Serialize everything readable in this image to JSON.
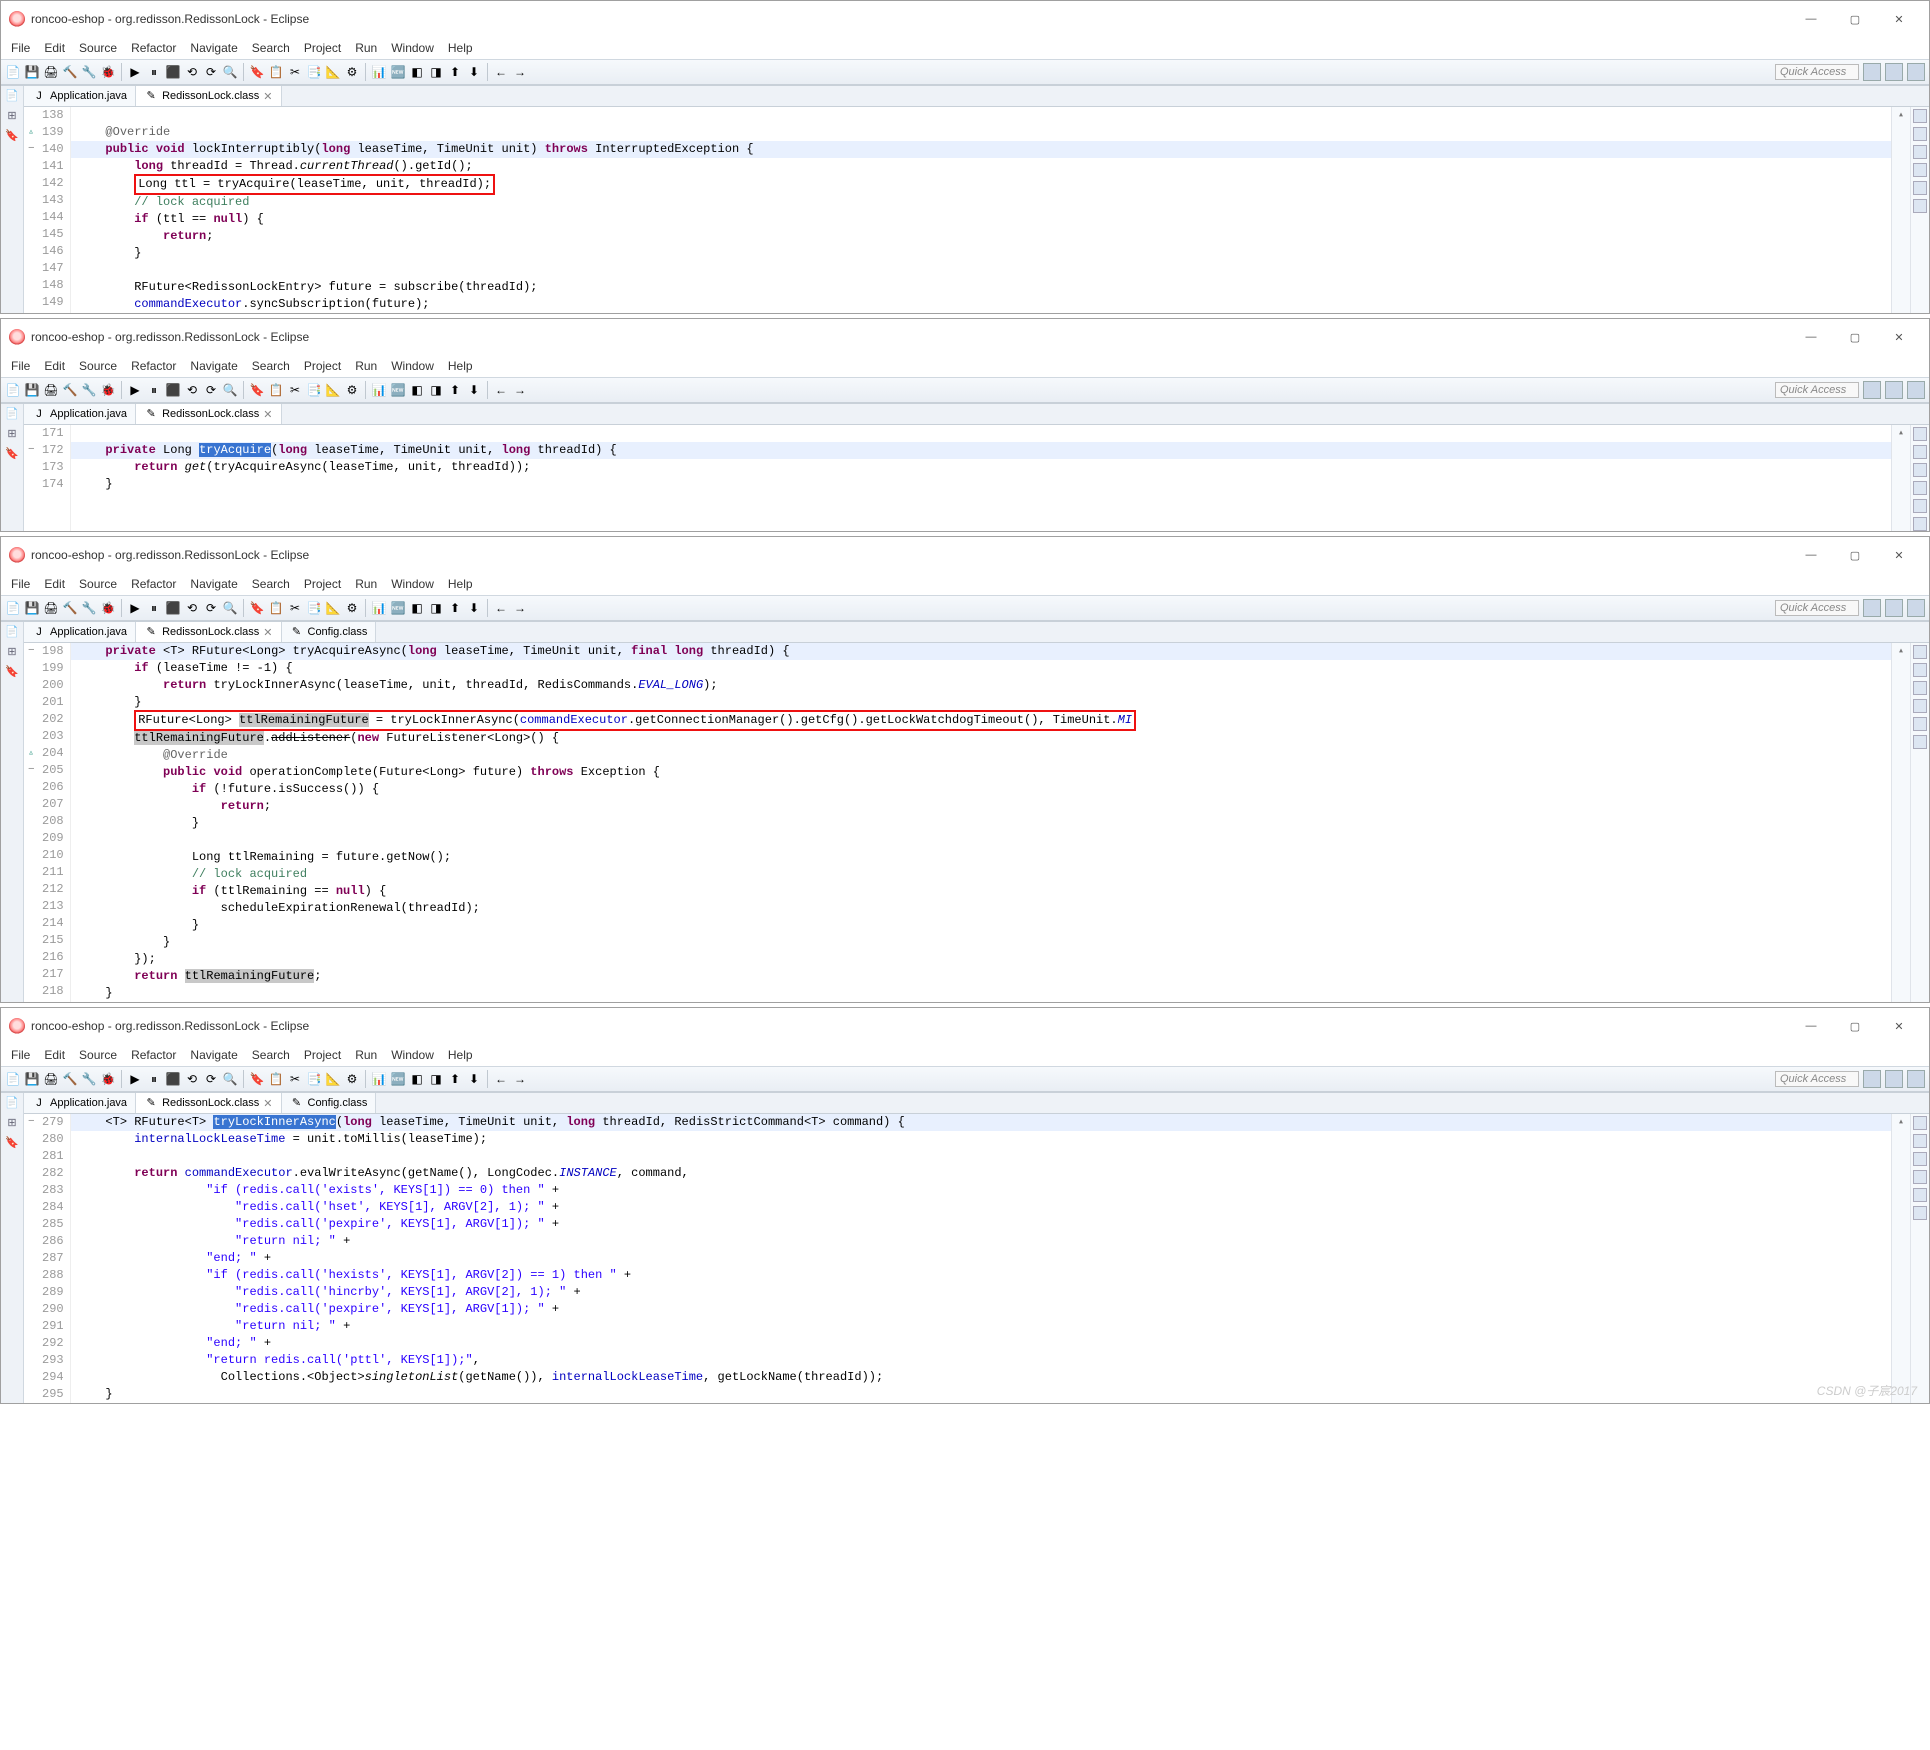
{
  "windows": [
    {
      "title": "roncoo-eshop - org.redisson.RedissonLock - Eclipse",
      "menus": [
        "File",
        "Edit",
        "Source",
        "Refactor",
        "Navigate",
        "Search",
        "Project",
        "Run",
        "Window",
        "Help"
      ],
      "quick_access": "Quick Access",
      "tabs": [
        {
          "label": "Application.java",
          "icon": "J",
          "active": false
        },
        {
          "label": "RedissonLock.class",
          "icon": "✎",
          "active": true,
          "closable": true
        }
      ],
      "code": {
        "first_line": 138,
        "lines": [
          {
            "n": 138,
            "html": ""
          },
          {
            "n": 139,
            "marker": "override",
            "html": "    <span class='ann'>@Override</span>"
          },
          {
            "n": 140,
            "marker": "minus",
            "hl": true,
            "html": "    <span class='kw'>public void</span> lockInterruptibly(<span class='kw'>long</span> leaseTime, TimeUnit unit) <span class='kw'>throws</span> InterruptedException {"
          },
          {
            "n": 141,
            "html": "        <span class='kw'>long</span> threadId = Thread.<span class='mth-static'>currentThread</span>().getId();"
          },
          {
            "n": 142,
            "html": "        <span class='redbox'>Long ttl = tryAcquire(leaseTime, unit, threadId);</span>"
          },
          {
            "n": 143,
            "html": "        <span class='cm'>// lock acquired</span>"
          },
          {
            "n": 144,
            "html": "        <span class='kw'>if</span> (ttl == <span class='kw'>null</span>) {"
          },
          {
            "n": 145,
            "html": "            <span class='kw'>return</span>;"
          },
          {
            "n": 146,
            "html": "        }"
          },
          {
            "n": 147,
            "html": ""
          },
          {
            "n": 148,
            "html": "        RFuture&lt;RedissonLockEntry&gt; future = subscribe(threadId);"
          },
          {
            "n": 149,
            "html": "        <span class='fld'>commandExecutor</span>.syncSubscription(future);"
          }
        ]
      }
    },
    {
      "title": "roncoo-eshop - org.redisson.RedissonLock - Eclipse",
      "menus": [
        "File",
        "Edit",
        "Source",
        "Refactor",
        "Navigate",
        "Search",
        "Project",
        "Run",
        "Window",
        "Help"
      ],
      "quick_access": "Quick Access",
      "tabs": [
        {
          "label": "Application.java",
          "icon": "J",
          "active": false
        },
        {
          "label": "RedissonLock.class",
          "icon": "✎",
          "active": true,
          "closable": true
        }
      ],
      "code": {
        "first_line": 171,
        "lines": [
          {
            "n": 171,
            "html": ""
          },
          {
            "n": 172,
            "marker": "minus",
            "hl": true,
            "html": "    <span class='kw'>private</span> Long <span class='sel'>tryAcquire</span>(<span class='kw'>long</span> leaseTime, TimeUnit unit, <span class='kw'>long</span> threadId) {"
          },
          {
            "n": 173,
            "html": "        <span class='kw'>return</span> <span class='mth-static'>get</span>(tryAcquireAsync(leaseTime, unit, threadId));"
          },
          {
            "n": 174,
            "html": "    }"
          }
        ]
      }
    },
    {
      "title": "roncoo-eshop - org.redisson.RedissonLock - Eclipse",
      "menus": [
        "File",
        "Edit",
        "Source",
        "Refactor",
        "Navigate",
        "Search",
        "Project",
        "Run",
        "Window",
        "Help"
      ],
      "quick_access": "Quick Access",
      "tabs": [
        {
          "label": "Application.java",
          "icon": "J",
          "active": false
        },
        {
          "label": "RedissonLock.class",
          "icon": "✎",
          "active": true,
          "closable": true
        },
        {
          "label": "Config.class",
          "icon": "✎",
          "active": false
        }
      ],
      "code": {
        "first_line": 198,
        "lines": [
          {
            "n": 198,
            "marker": "minus",
            "hl": true,
            "html": "    <span class='kw'>private</span> &lt;T&gt; RFuture&lt;Long&gt; tryAcquireAsync(<span class='kw'>long</span> leaseTime, TimeUnit unit, <span class='kw'>final long</span> threadId) {"
          },
          {
            "n": 199,
            "html": "        <span class='kw'>if</span> (leaseTime != -1) {"
          },
          {
            "n": 200,
            "html": "            <span class='kw'>return</span> tryLockInnerAsync(leaseTime, unit, threadId, RedisCommands.<span class='sfld'>EVAL_LONG</span>);"
          },
          {
            "n": 201,
            "html": "        }"
          },
          {
            "n": 202,
            "html": "        <span class='redbox'>RFuture&lt;Long&gt; <span class='selhl'>ttlRemainingFuture</span> = tryLockInnerAsync(<span class='fld'>commandExecutor</span>.getConnectionManager().getCfg().getLockWatchdogTimeout(), TimeUnit.<span class='sfld'>MI</span></span>"
          },
          {
            "n": 203,
            "html": "        <span class='selhl'>ttlRemainingFuture</span>.<del>addListener</del>(<span class='kw'>new</span> FutureListener&lt;Long&gt;() {"
          },
          {
            "n": 204,
            "marker": "override",
            "html": "            <span class='ann'>@Override</span>"
          },
          {
            "n": 205,
            "marker": "minus",
            "html": "            <span class='kw'>public void</span> operationComplete(Future&lt;Long&gt; future) <span class='kw'>throws</span> Exception {"
          },
          {
            "n": 206,
            "html": "                <span class='kw'>if</span> (!future.isSuccess()) {"
          },
          {
            "n": 207,
            "html": "                    <span class='kw'>return</span>;"
          },
          {
            "n": 208,
            "html": "                }"
          },
          {
            "n": 209,
            "html": ""
          },
          {
            "n": 210,
            "html": "                Long ttlRemaining = future.getNow();"
          },
          {
            "n": 211,
            "html": "                <span class='cm'>// lock acquired</span>"
          },
          {
            "n": 212,
            "html": "                <span class='kw'>if</span> (ttlRemaining == <span class='kw'>null</span>) {"
          },
          {
            "n": 213,
            "html": "                    scheduleExpirationRenewal(threadId);"
          },
          {
            "n": 214,
            "html": "                }"
          },
          {
            "n": 215,
            "html": "            }"
          },
          {
            "n": 216,
            "html": "        });"
          },
          {
            "n": 217,
            "html": "        <span class='kw'>return</span> <span class='selhl'>ttlRemainingFuture</span>;"
          },
          {
            "n": 218,
            "html": "    }"
          }
        ]
      }
    },
    {
      "title": "roncoo-eshop - org.redisson.RedissonLock - Eclipse",
      "menus": [
        "File",
        "Edit",
        "Source",
        "Refactor",
        "Navigate",
        "Search",
        "Project",
        "Run",
        "Window",
        "Help"
      ],
      "quick_access": "Quick Access",
      "tabs": [
        {
          "label": "Application.java",
          "icon": "J",
          "active": false
        },
        {
          "label": "RedissonLock.class",
          "icon": "✎",
          "active": true,
          "closable": true
        },
        {
          "label": "Config.class",
          "icon": "✎",
          "active": false
        }
      ],
      "code": {
        "first_line": 279,
        "lines": [
          {
            "n": 279,
            "marker": "minus",
            "hl": true,
            "html": "    &lt;T&gt; RFuture&lt;T&gt; <span class='sel'>tryLockInnerAsync</span>(<span class='kw'>long</span> leaseTime, TimeUnit unit, <span class='kw'>long</span> threadId, RedisStrictCommand&lt;T&gt; command) {"
          },
          {
            "n": 280,
            "html": "        <span class='fld'>internalLockLeaseTime</span> = unit.toMillis(leaseTime);"
          },
          {
            "n": 281,
            "html": ""
          },
          {
            "n": 282,
            "html": "        <span class='kw'>return</span> <span class='fld'>commandExecutor</span>.evalWriteAsync(getName(), LongCodec.<span class='sfld'>INSTANCE</span>, command,"
          },
          {
            "n": 283,
            "html": "                  <span class='str'>\"if (redis.call('exists', KEYS[1]) == 0) then \"</span> +"
          },
          {
            "n": 284,
            "html": "                      <span class='str'>\"redis.call('hset', KEYS[1], ARGV[2], 1); \"</span> +"
          },
          {
            "n": 285,
            "html": "                      <span class='str'>\"redis.call('pexpire', KEYS[1], ARGV[1]); \"</span> +"
          },
          {
            "n": 286,
            "html": "                      <span class='str'>\"return nil; \"</span> +"
          },
          {
            "n": 287,
            "html": "                  <span class='str'>\"end; \"</span> +"
          },
          {
            "n": 288,
            "html": "                  <span class='str'>\"if (redis.call('hexists', KEYS[1], ARGV[2]) == 1) then \"</span> +"
          },
          {
            "n": 289,
            "html": "                      <span class='str'>\"redis.call('hincrby', KEYS[1], ARGV[2], 1); \"</span> +"
          },
          {
            "n": 290,
            "html": "                      <span class='str'>\"redis.call('pexpire', KEYS[1], ARGV[1]); \"</span> +"
          },
          {
            "n": 291,
            "html": "                      <span class='str'>\"return nil; \"</span> +"
          },
          {
            "n": 292,
            "html": "                  <span class='str'>\"end; \"</span> +"
          },
          {
            "n": 293,
            "html": "                  <span class='str'>\"return redis.call('pttl', KEYS[1]);\"</span>,"
          },
          {
            "n": 294,
            "html": "                    Collections.&lt;Object&gt;<span class='mth-static'>singletonList</span>(getName()), <span class='fld'>internalLockLeaseTime</span>, getLockName(threadId));"
          },
          {
            "n": 295,
            "html": "    }"
          }
        ]
      }
    }
  ],
  "watermark": "CSDN @子宸2017",
  "toolbar_icons": [
    "📄",
    "💾",
    "🖨",
    "🔨",
    "🔧",
    "🐞",
    "▶",
    "⏸",
    "⬛",
    "⟲",
    "⟳",
    "🔍",
    "🔖",
    "📋",
    "✂",
    "📑",
    "📐",
    "⚙",
    "📊",
    "🆕",
    "◧",
    "◨",
    "⬆",
    "⬇",
    "←",
    "→"
  ],
  "left_gutter_icons": [
    "📄",
    "⊞",
    "🔖"
  ],
  "ov_icons": [
    "▭",
    "▭",
    "▭",
    "▭",
    "▭",
    "▭"
  ]
}
